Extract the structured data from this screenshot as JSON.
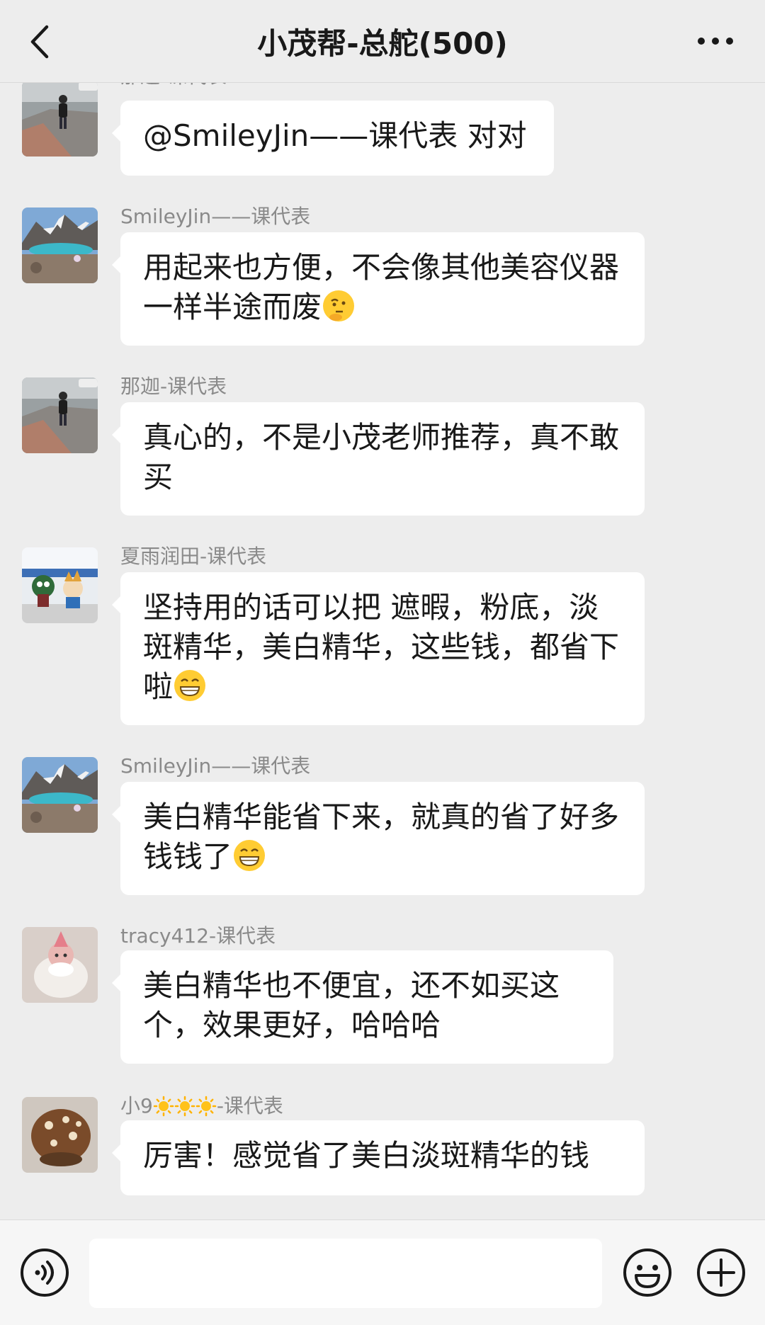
{
  "header": {
    "title": "小茂帮-总舵(500)",
    "back_icon": "chevron-left-icon",
    "more_icon": "more-icon"
  },
  "messages": [
    {
      "sender": "那迦-课代表",
      "avatar": "avatar-naja",
      "text": "@SmileyJin——课代表 对对",
      "emoji": ""
    },
    {
      "sender": "SmileyJin——课代表",
      "avatar": "avatar-smileyjin",
      "text": "用起来也方便，不会像其他美容仪器一样半途而废",
      "emoji": "thinking-face"
    },
    {
      "sender": "那迦-课代表",
      "avatar": "avatar-naja",
      "text": "真心的，不是小茂老师推荐，真不敢买",
      "emoji": ""
    },
    {
      "sender": "夏雨润田-课代表",
      "avatar": "avatar-xiayu",
      "text": "坚持用的话可以把 遮暇，粉底，淡斑精华，美白精华，这些钱，都省下啦",
      "emoji": "grinning-face"
    },
    {
      "sender": "SmileyJin——课代表",
      "avatar": "avatar-smileyjin",
      "text": "美白精华能省下来，就真的省了好多钱钱了",
      "emoji": "grinning-face"
    },
    {
      "sender": "tracy412-课代表",
      "avatar": "avatar-tracy",
      "text": "美白精华也不便宜，还不如买这个，效果更好，哈哈哈",
      "emoji": ""
    },
    {
      "sender_prefix": "小9",
      "sender_suffix": "-课代表",
      "sender_icons": "sun-icon x3",
      "avatar": "avatar-xiao9",
      "text": "厉害！感觉省了美白淡斑精华的钱",
      "emoji": ""
    }
  ],
  "input_bar": {
    "voice_icon": "voice-icon",
    "emoji_icon": "emoji-icon",
    "plus_icon": "plus-icon",
    "text_value": ""
  },
  "colors": {
    "background": "#ededed",
    "bubble": "#ffffff",
    "sender_text": "#8a8a8a",
    "message_text": "#191919"
  }
}
